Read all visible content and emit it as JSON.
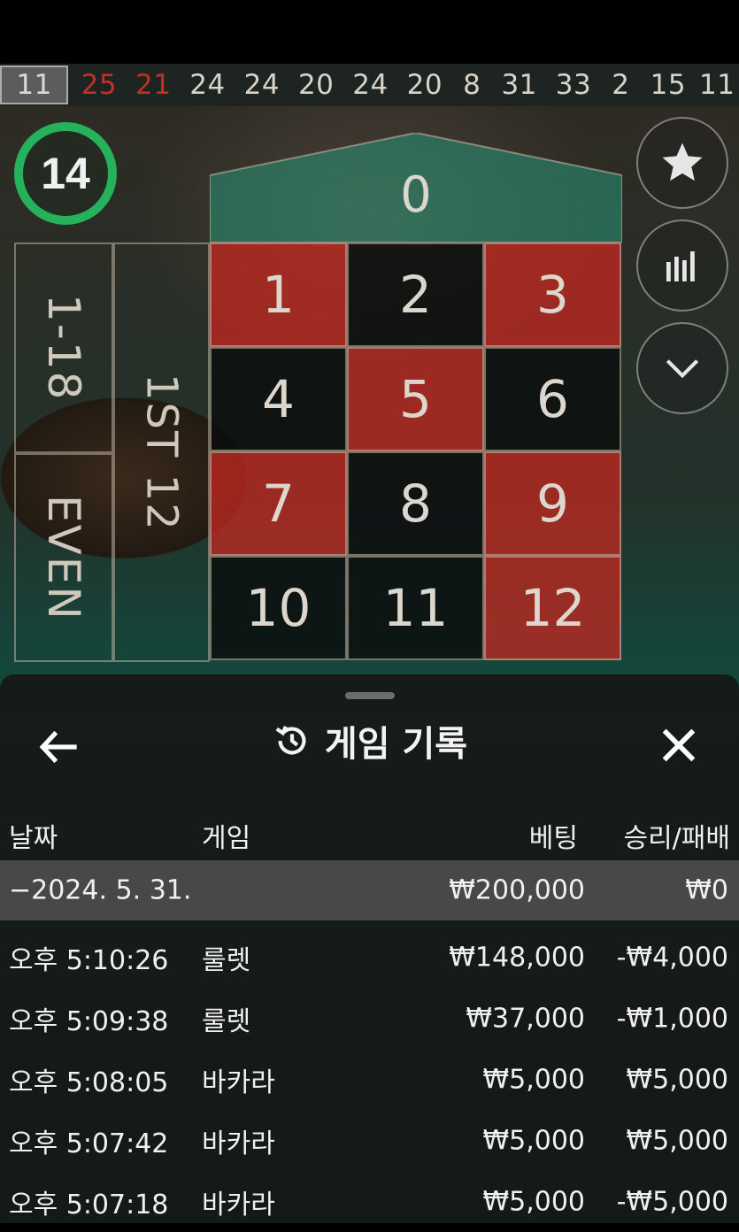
{
  "history": [
    {
      "n": "11",
      "color": "grey"
    },
    {
      "n": "25",
      "color": "red"
    },
    {
      "n": "21",
      "color": "red"
    },
    {
      "n": "24",
      "color": "white"
    },
    {
      "n": "24",
      "color": "white"
    },
    {
      "n": "20",
      "color": "white"
    },
    {
      "n": "24",
      "color": "white"
    },
    {
      "n": "20",
      "color": "white"
    },
    {
      "n": "8",
      "color": "white"
    },
    {
      "n": "31",
      "color": "white"
    },
    {
      "n": "33",
      "color": "white"
    },
    {
      "n": "2",
      "color": "white"
    },
    {
      "n": "15",
      "color": "white"
    },
    {
      "n": "11",
      "color": "white"
    }
  ],
  "timer": {
    "value": "14",
    "color": "#25b25a"
  },
  "table": {
    "zero": "0",
    "cells": [
      "1",
      "2",
      "3",
      "4",
      "5",
      "6",
      "7",
      "8",
      "9",
      "10",
      "11",
      "12"
    ],
    "outside": {
      "low": "1-18",
      "even": "EVEN",
      "dozen": "1ST 12"
    }
  },
  "side_buttons": [
    "star-icon",
    "stats-icon",
    "chevron-down-icon"
  ],
  "panel": {
    "title": "게임 기록",
    "columns": {
      "date": "날짜",
      "game": "게임",
      "bet": "베팅",
      "result": "승리/패배"
    },
    "date_row": {
      "date": "−2024. 5. 31.",
      "bet": "₩200,000",
      "result": "₩0"
    },
    "rows": [
      {
        "time": "오후 5:10:26",
        "game": "룰렛",
        "bet": "₩148,000",
        "result": "-₩4,000"
      },
      {
        "time": "오후 5:09:38",
        "game": "룰렛",
        "bet": "₩37,000",
        "result": "-₩1,000"
      },
      {
        "time": "오후 5:08:05",
        "game": "바카라",
        "bet": "₩5,000",
        "result": "₩5,000"
      },
      {
        "time": "오후 5:07:42",
        "game": "바카라",
        "bet": "₩5,000",
        "result": "₩5,000"
      },
      {
        "time": "오후 5:07:18",
        "game": "바카라",
        "bet": "₩5,000",
        "result": "-₩5,000"
      }
    ]
  }
}
